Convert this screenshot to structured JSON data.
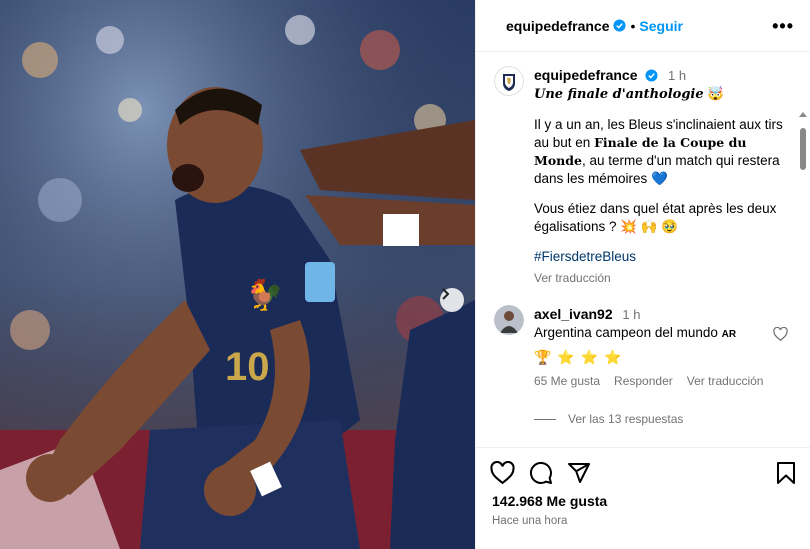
{
  "header": {
    "username": "equipedefrance",
    "separator": "•",
    "follow_label": "Seguir",
    "more_label": "•••"
  },
  "caption": {
    "username": "equipedefrance",
    "time": "1 h",
    "title": "Une finale d'anthologie",
    "title_emoji": "🤯",
    "p1_start": "Il y a un an, les Bleus s'inclinaient aux tirs au but en ",
    "p1_bold": "Finale de la Coupe du Monde",
    "p1_end": ", au terme d'un match qui restera dans les mémoires 💙",
    "p2": "Vous étiez dans quel état après les deux égalisations ? 💥 🙌 🥹",
    "hashtag": "#FiersdetreBleus",
    "see_translation": "Ver traducción"
  },
  "comment": {
    "username": "axel_ivan92",
    "time": "1 h",
    "text": "Argentina campeon del mundo",
    "flag": "AR",
    "stars": "🏆 ⭐ ⭐ ⭐",
    "likes": "65 Me gusta",
    "reply": "Responder",
    "translate": "Ver traducción",
    "view_replies": "Ver las 13 respuestas"
  },
  "footer": {
    "likes": "142.968 Me gusta",
    "time_ago": "Hace una hora"
  },
  "colors": {
    "link_blue": "#0095f6",
    "verified_blue": "#0095f6",
    "muted": "#737373",
    "hashtag": "#00376b",
    "jersey_navy": "#1c2c55"
  }
}
